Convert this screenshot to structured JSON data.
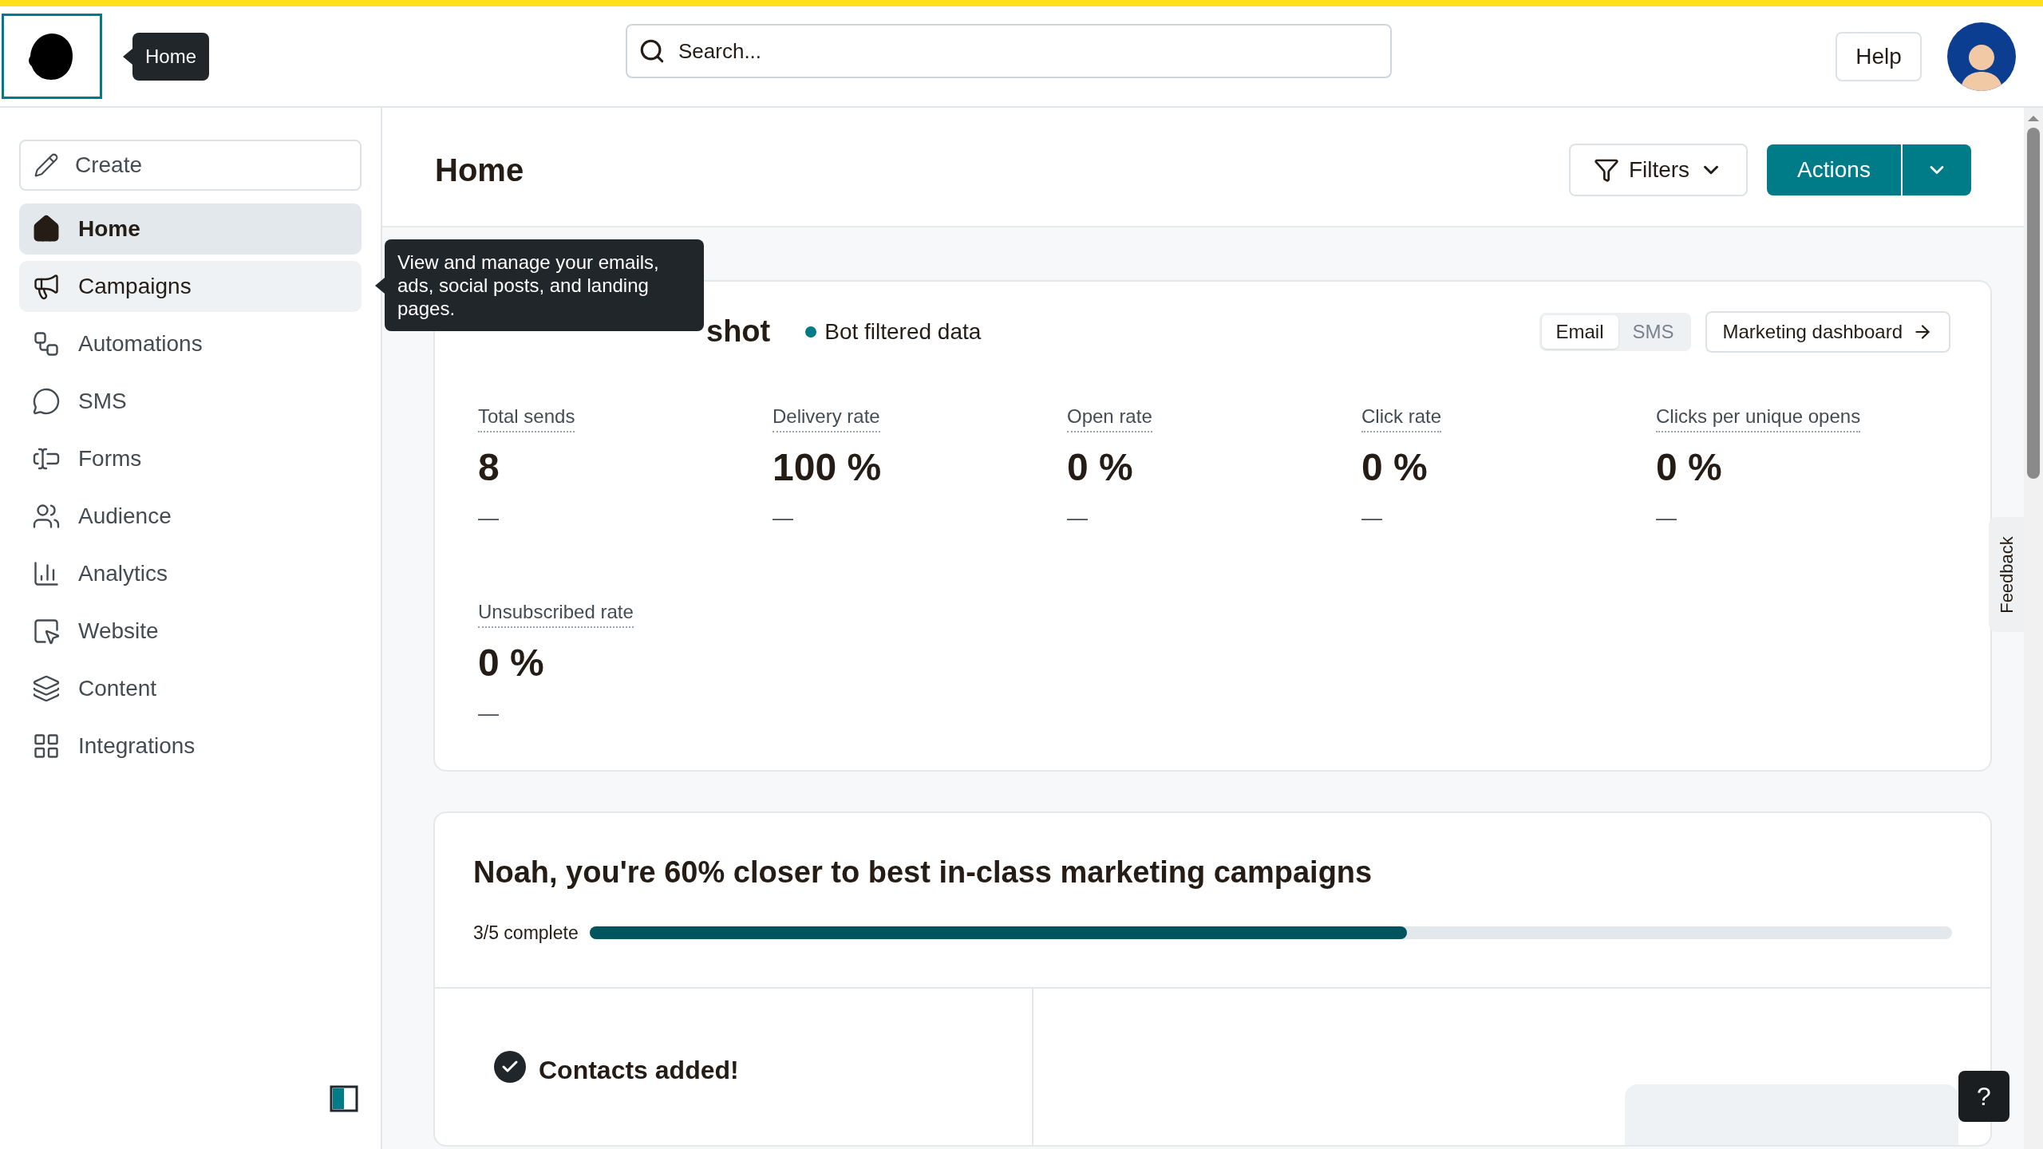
{
  "header": {
    "logo_tooltip": "Home",
    "search": {
      "placeholder": "Search..."
    },
    "help": "Help"
  },
  "sidebar": {
    "create": "Create",
    "items": [
      {
        "label": "Home",
        "selected": true,
        "hovered": false
      },
      {
        "label": "Campaigns",
        "selected": false,
        "hovered": true
      },
      {
        "label": "Automations",
        "selected": false,
        "hovered": false
      },
      {
        "label": "SMS",
        "selected": false,
        "hovered": false
      },
      {
        "label": "Forms",
        "selected": false,
        "hovered": false
      },
      {
        "label": "Audience",
        "selected": false,
        "hovered": false
      },
      {
        "label": "Analytics",
        "selected": false,
        "hovered": false
      },
      {
        "label": "Website",
        "selected": false,
        "hovered": false
      },
      {
        "label": "Content",
        "selected": false,
        "hovered": false
      },
      {
        "label": "Integrations",
        "selected": false,
        "hovered": false
      }
    ],
    "tooltip": "View and manage your emails, ads, social posts, and landing pages."
  },
  "page": {
    "title": "Home",
    "filters": "Filters",
    "actions": "Actions"
  },
  "snapshot": {
    "title": "shot",
    "badge": "Bot filtered data",
    "channels": [
      {
        "label": "Email",
        "selected": true
      },
      {
        "label": "SMS",
        "selected": false
      }
    ],
    "dashboard_link": "Marketing dashboard",
    "metrics": [
      {
        "label": "Total sends",
        "value": "8",
        "change": "—"
      },
      {
        "label": "Delivery rate",
        "value": "100 %",
        "change": "—"
      },
      {
        "label": "Open rate",
        "value": "0 %",
        "change": "—"
      },
      {
        "label": "Click rate",
        "value": "0 %",
        "change": "—"
      },
      {
        "label": "Clicks per unique opens",
        "value": "0 %",
        "change": "—"
      },
      {
        "label": "Unsubscribed rate",
        "value": "0 %",
        "change": "—"
      }
    ]
  },
  "progress_card": {
    "title": "Noah, you're 60% closer to best in-class marketing campaigns",
    "status": "3/5 complete",
    "level": 0.6,
    "step": "Contacts added!"
  },
  "feedback": "Feedback",
  "help_fab": "?"
}
